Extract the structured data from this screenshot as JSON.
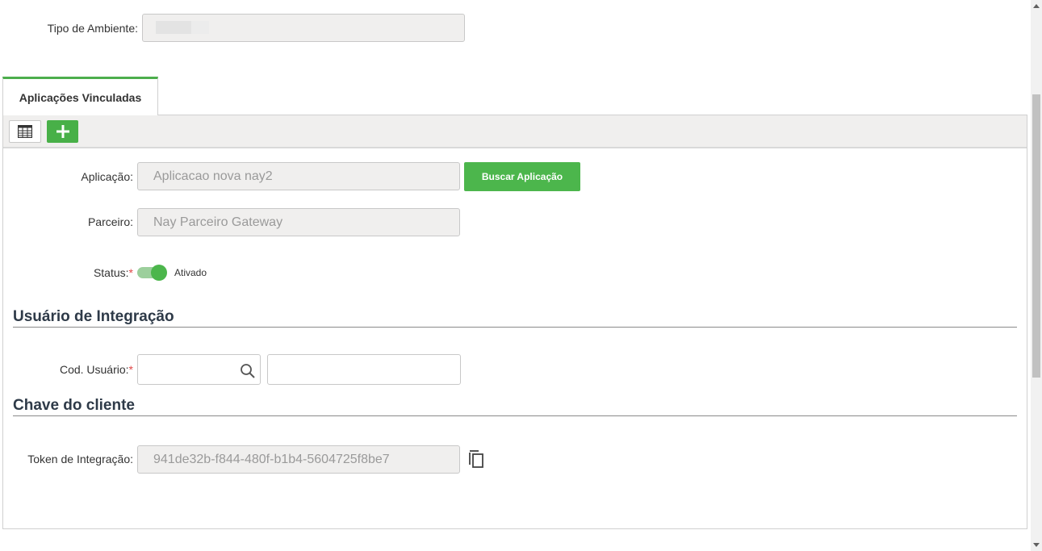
{
  "top": {
    "tipo_label": "Tipo de Ambiente:"
  },
  "tab": {
    "label": "Aplicações Vinculadas"
  },
  "toolbar": {
    "grid_icon": "table-grid-icon",
    "add_icon": "plus-icon"
  },
  "form": {
    "aplicacao_label": "Aplicação:",
    "aplicacao_value": "Aplicacao nova nay2",
    "buscar_label": "Buscar Aplicação",
    "parceiro_label": "Parceiro:",
    "parceiro_value": "Nay Parceiro Gateway",
    "status_label": "Status:",
    "required_mark": "*",
    "status_value": "Ativado"
  },
  "usuario": {
    "title": "Usuário de Integração",
    "cod_label": "Cod. Usuário:",
    "cod_value": "",
    "name_value": ""
  },
  "chave": {
    "title": "Chave do cliente",
    "token_label": "Token de Integração:",
    "token_value": "941de32b-f844-480f-b1b4-5604725f8be7"
  },
  "colors": {
    "accent": "#4cb64c",
    "toolbar_bg": "#f0efee",
    "section_title": "#2e3a48"
  }
}
